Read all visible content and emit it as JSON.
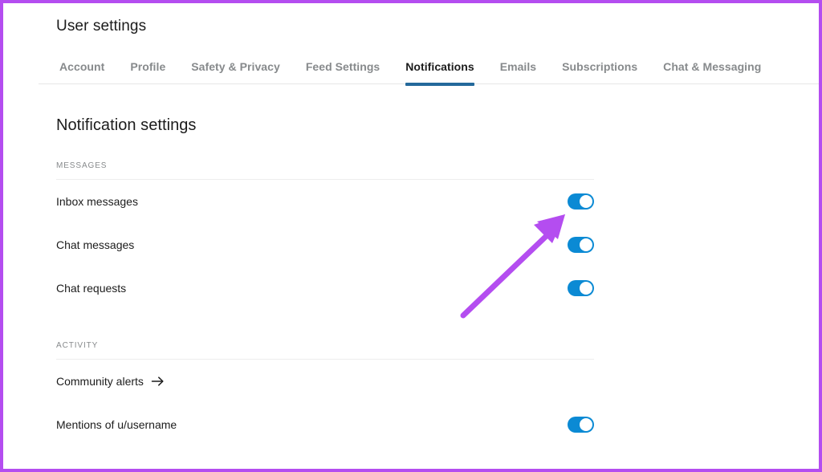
{
  "frame": {
    "border_color": "#b44df0"
  },
  "header": {
    "title": "User settings"
  },
  "tabs": [
    {
      "label": "Account",
      "active": false
    },
    {
      "label": "Profile",
      "active": false
    },
    {
      "label": "Safety & Privacy",
      "active": false
    },
    {
      "label": "Feed Settings",
      "active": false
    },
    {
      "label": "Notifications",
      "active": true
    },
    {
      "label": "Emails",
      "active": false
    },
    {
      "label": "Subscriptions",
      "active": false
    },
    {
      "label": "Chat & Messaging",
      "active": false
    }
  ],
  "main": {
    "heading": "Notification settings",
    "groups": [
      {
        "label": "MESSAGES",
        "rows": [
          {
            "label": "Inbox messages",
            "control": "toggle",
            "state": "on"
          },
          {
            "label": "Chat messages",
            "control": "toggle",
            "state": "on"
          },
          {
            "label": "Chat requests",
            "control": "toggle",
            "state": "on"
          }
        ]
      },
      {
        "label": "ACTIVITY",
        "rows": [
          {
            "label": "Community alerts",
            "control": "arrow",
            "icon": "arrow-right-icon"
          },
          {
            "label": "Mentions of u/username",
            "control": "toggle",
            "state": "on"
          }
        ]
      }
    ]
  },
  "colors": {
    "toggle_on": "#0b8ad4",
    "active_tab_underline": "#24699b",
    "annotation_arrow": "#b44df0",
    "text_primary": "#1c1c1c",
    "text_muted": "#878a8c"
  }
}
